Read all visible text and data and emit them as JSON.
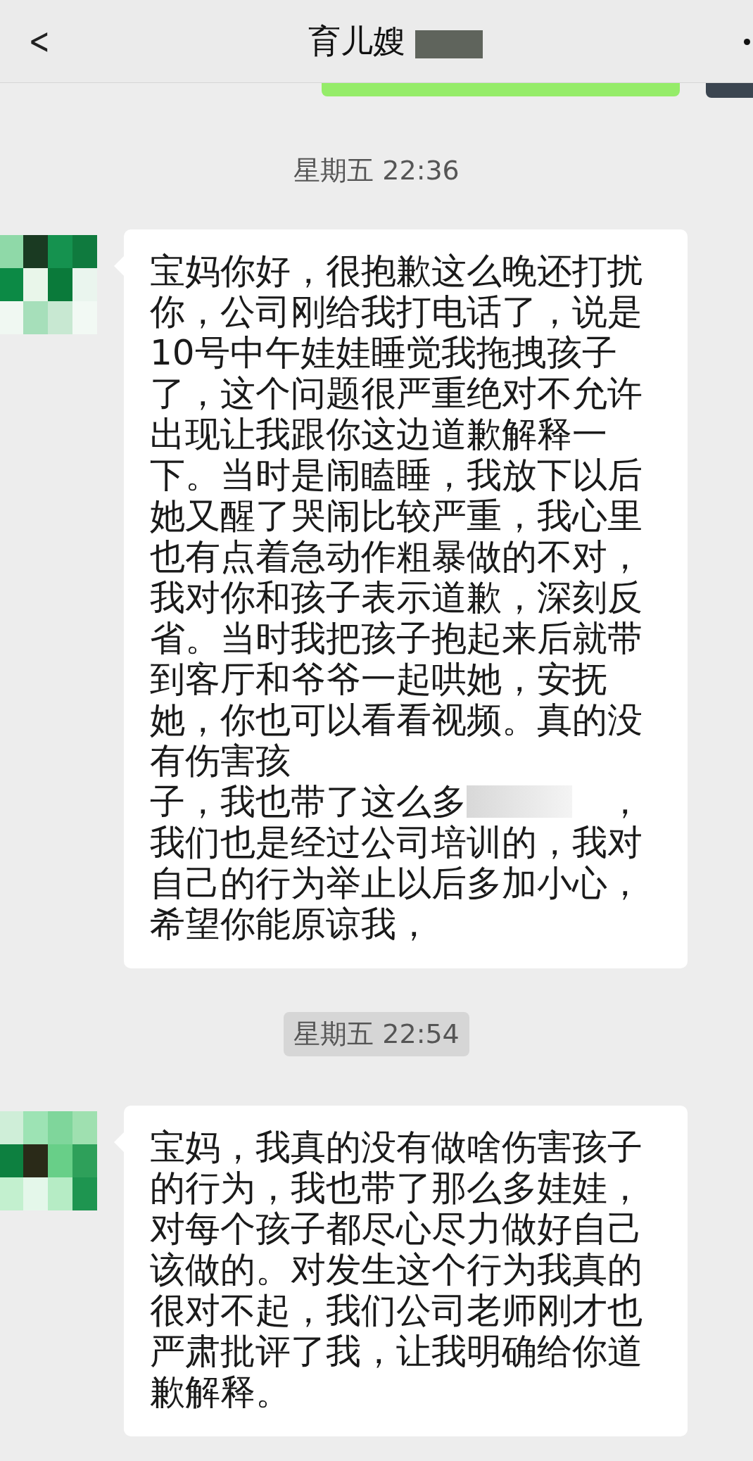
{
  "header": {
    "back": "<",
    "title": "育儿嫂",
    "title_redacted": true
  },
  "messages": [
    {
      "kind": "sent_partial"
    },
    {
      "kind": "time",
      "text": "星期五 22:36",
      "highlighted": false
    },
    {
      "kind": "received",
      "parts": [
        {
          "kind": "text",
          "text": "宝妈你好，很抱歉这么晚还打扰你，公司刚给我打电话了，说是10号中午娃娃睡觉我拖拽孩子了，这个问题很严重绝对不允许出现让我跟你这边道歉解释一下。当时是闹瞌睡，我放下以后她又醒了哭闹比较严重，我心里也有点着急动作粗暴做的不对，我对你和孩子表示道歉，深刻反省。当时我把孩子抱起来后就带到客厅和爷爷一起哄她，安抚她，你也可以看看视频。真的没有伤害孩"
        },
        {
          "kind": "line",
          "segments": [
            {
              "kind": "text",
              "text": "子，我也带了这么多"
            },
            {
              "kind": "redacted"
            },
            {
              "kind": "text",
              "text": "，"
            }
          ]
        },
        {
          "kind": "text",
          "text": "我们也是经过公司培训的，我对自己的行为举止以后多加小心，希望你能原谅我，"
        }
      ]
    },
    {
      "kind": "time",
      "text": "星期五 22:54",
      "highlighted": true
    },
    {
      "kind": "received",
      "parts": [
        {
          "kind": "text",
          "text": "宝妈，我真的没有做啥伤害孩子的行为，我也带了那么多娃娃，对每个孩子都尽心尽力做好自己该做的。对发生这个行为我真的很对不起，我们公司老师刚才也严肃批评了我，让我明确给你道歉解释。"
        }
      ]
    }
  ]
}
